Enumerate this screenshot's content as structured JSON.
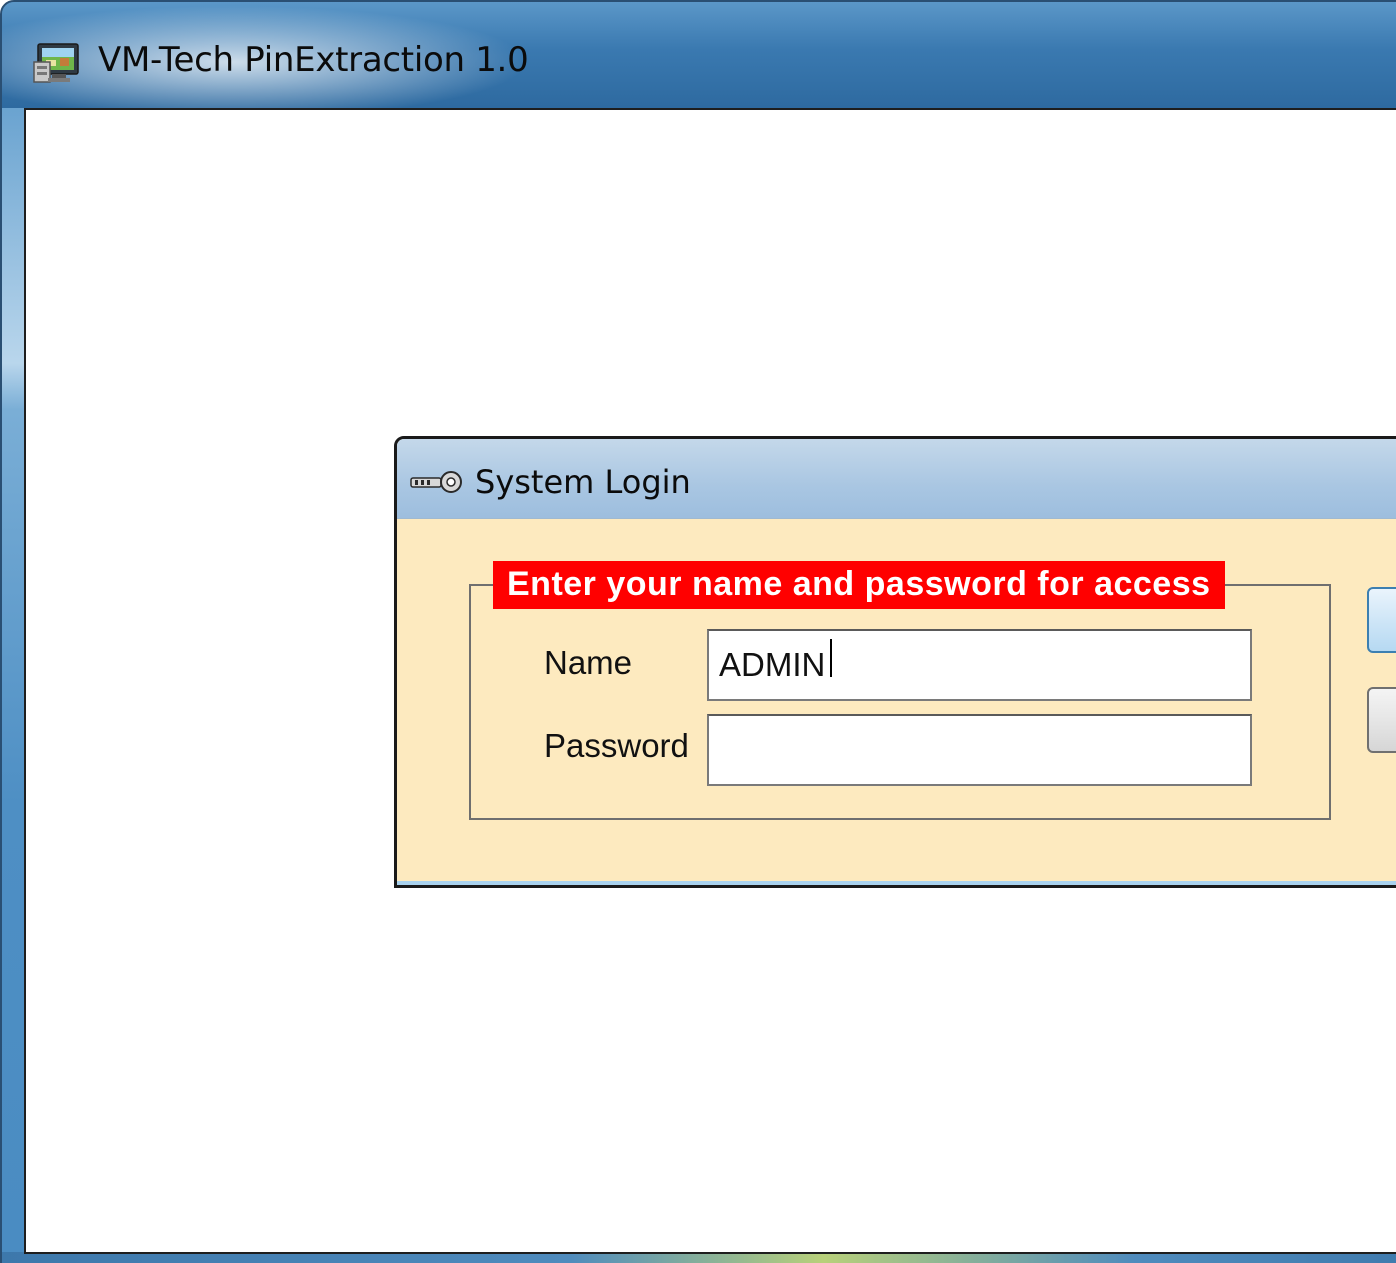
{
  "main_window": {
    "title": "VM-Tech PinExtraction 1.0",
    "app_icon": "monitor-app-icon"
  },
  "login_dialog": {
    "title": "System Login",
    "title_icon": "key-icon",
    "group_title": "Enter your name and password for access",
    "name": {
      "label": "Name",
      "value": "ADMIN",
      "placeholder": ""
    },
    "password": {
      "label": "Password",
      "value": "",
      "placeholder": ""
    },
    "buttons": {
      "ok_label": "",
      "cancel_label": ""
    }
  },
  "colors": {
    "titlebar_blue": "#3a79b0",
    "dialog_background": "#fdeabf",
    "legend_red": "#ff0000",
    "legend_text": "#ffffff"
  }
}
